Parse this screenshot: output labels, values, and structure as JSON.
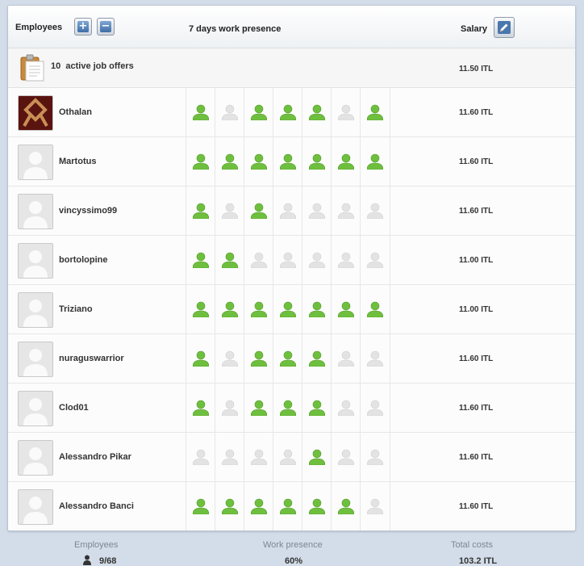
{
  "header": {
    "employees_label": "Employees",
    "presence_label": "7 days work presence",
    "salary_label": "Salary"
  },
  "job_offers": {
    "count": "10",
    "label": "active job offers",
    "salary": "11.50 ITL"
  },
  "employees": [
    {
      "name": "Othalan",
      "salary": "11.60 ITL",
      "avatar": "custom-rune",
      "presence": [
        1,
        0,
        1,
        1,
        1,
        0,
        1
      ]
    },
    {
      "name": "Martotus",
      "salary": "11.60 ITL",
      "avatar": "default",
      "presence": [
        1,
        1,
        1,
        1,
        1,
        1,
        1
      ]
    },
    {
      "name": "vincyssimo99",
      "salary": "11.60 ITL",
      "avatar": "default",
      "presence": [
        1,
        0,
        1,
        0,
        0,
        0,
        0
      ]
    },
    {
      "name": "bortolopine",
      "salary": "11.00 ITL",
      "avatar": "default",
      "presence": [
        1,
        1,
        0,
        0,
        0,
        0,
        0
      ]
    },
    {
      "name": "Triziano",
      "salary": "11.00 ITL",
      "avatar": "default",
      "presence": [
        1,
        1,
        1,
        1,
        1,
        1,
        1
      ]
    },
    {
      "name": "nuraguswarrior",
      "salary": "11.60 ITL",
      "avatar": "default",
      "presence": [
        1,
        0,
        1,
        1,
        1,
        0,
        0
      ]
    },
    {
      "name": "Clod01",
      "salary": "11.60 ITL",
      "avatar": "default",
      "presence": [
        1,
        0,
        1,
        1,
        1,
        0,
        0
      ]
    },
    {
      "name": "Alessandro Pikar",
      "salary": "11.60 ITL",
      "avatar": "default",
      "presence": [
        0,
        0,
        0,
        0,
        1,
        0,
        0
      ]
    },
    {
      "name": "Alessandro Banci",
      "salary": "11.60 ITL",
      "avatar": "default",
      "presence": [
        1,
        1,
        1,
        1,
        1,
        1,
        0
      ]
    }
  ],
  "stats": {
    "employees_label": "Employees",
    "employees_value": "9/68",
    "presence_label": "Work presence",
    "presence_value": "60%",
    "costs_label": "Total costs",
    "costs_value": "103.2 ITL"
  },
  "colors": {
    "present": "#6fbf3f",
    "absent": "#e3e3e3",
    "button_blue": "#3f6ea8"
  },
  "icons": {
    "add": "plus-icon",
    "remove": "minus-icon",
    "edit": "pencil-icon",
    "offers": "clipboard-icon",
    "presence": "person-icon"
  }
}
